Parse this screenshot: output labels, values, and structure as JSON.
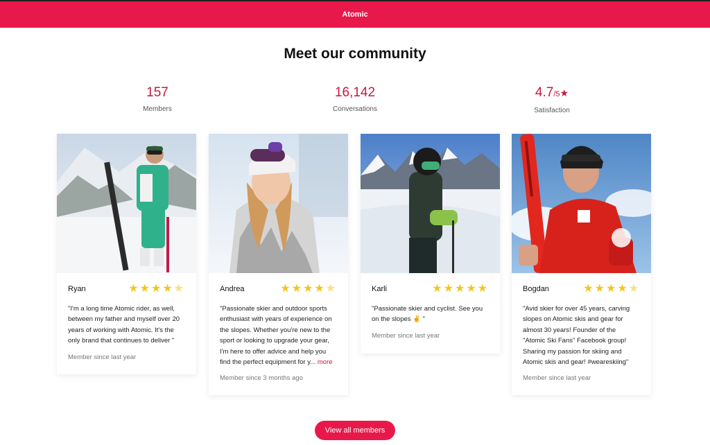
{
  "header": {
    "brand": "Atomic"
  },
  "page": {
    "title": "Meet our community"
  },
  "stats": {
    "members": {
      "value": "157",
      "label": "Members"
    },
    "conversations": {
      "value": "16,142",
      "label": "Conversations"
    },
    "satisfaction": {
      "value": "4.7",
      "suffix": "/5",
      "label": "Satisfaction"
    }
  },
  "members": [
    {
      "name": "Ryan",
      "rating": 4.5,
      "stars": "★★★★",
      "quote": "\"I'm a long time Atomic rider, as well, between my father and myself over 20 years of working with Atomic. It's the only brand that continues to deliver \"",
      "more": "",
      "since": "Member since last year"
    },
    {
      "name": "Andrea",
      "rating": 4.5,
      "stars": "★★★★",
      "quote": "\"Passionate skier and outdoor sports enthusiast with years of experience on the slopes. Whether you're new to the sport or looking to upgrade your gear, I'm here to offer advice and help you find the perfect equipment for y...",
      "more": "more",
      "since": "Member since 3 months ago"
    },
    {
      "name": "Karli",
      "rating": 5,
      "stars": "★★★★★",
      "quote": "\"Passionate skier and cyclist. See you on the slopes ✌ \"",
      "more": "",
      "since": "Member since last year"
    },
    {
      "name": "Bogdan",
      "rating": 4.5,
      "stars": "★★★★",
      "quote": "\"Avid skier for over 45 years, carving slopes on Atomic skis and gear for almost 30 years! Founder of the \"Atomic Ski Fans\" Facebook group! Sharing my passion for skiing and Atomic skis and gear! #weareskiing\"",
      "more": "",
      "since": "Member since last year"
    }
  ],
  "cta": {
    "label": "View all members"
  },
  "colors": {
    "accent": "#e8194a",
    "accent_text": "#c8163f",
    "star": "#f5c518"
  }
}
